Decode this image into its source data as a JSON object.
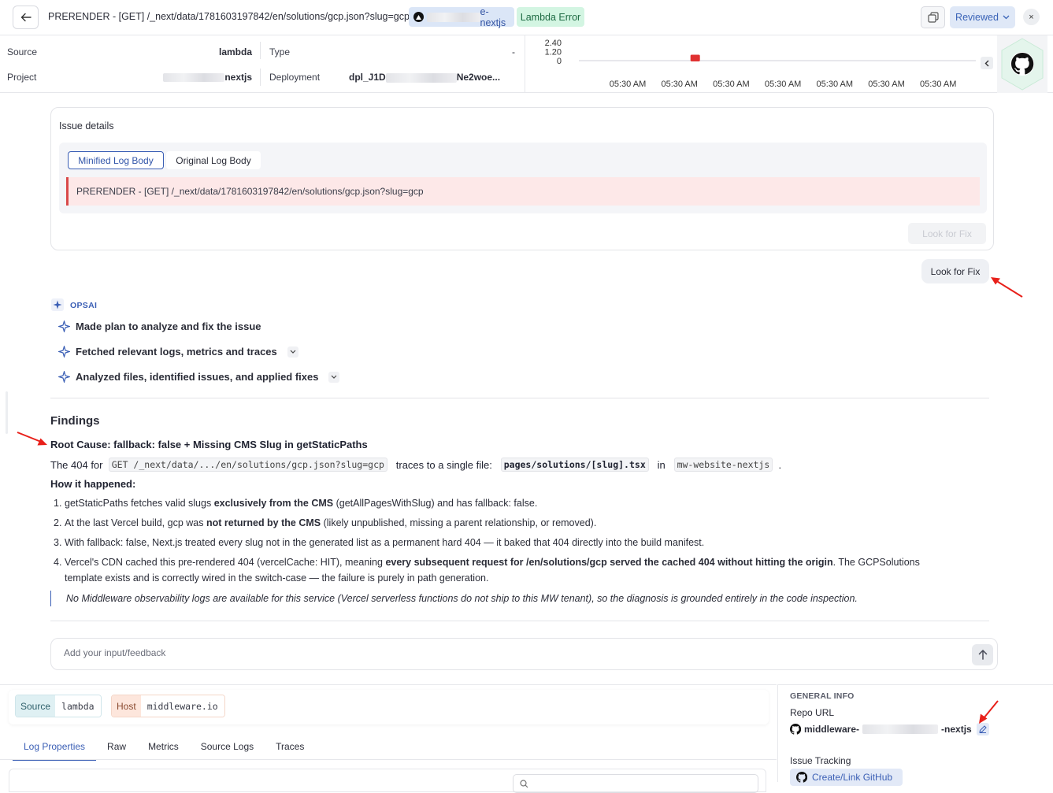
{
  "header": {
    "title": "PRERENDER - [GET] /_next/data/1781603197842/en/solutions/gcp.json?slug=gcp",
    "project_badge": "e-nextjs",
    "error_badge": "Lambda Error",
    "reviewed_label": "Reviewed",
    "close_glyph": "×"
  },
  "meta": {
    "source_label": "Source",
    "source_value": "lambda",
    "project_label": "Project",
    "project_value": "nextjs",
    "type_label": "Type",
    "type_value": "-",
    "deployment_label": "Deployment",
    "deployment_prefix": "dpl_J1D",
    "deployment_suffix": "Ne2woe..."
  },
  "chart_data": {
    "type": "bar",
    "y_ticks": [
      "2.40",
      "1.20",
      "0"
    ],
    "ylim": [
      0,
      2.4
    ],
    "categories": [
      "05:30 AM",
      "05:30 AM",
      "05:30 AM",
      "05:30 AM",
      "05:30 AM",
      "05:30 AM",
      "05:30 AM"
    ],
    "bar_color": "#e03131",
    "series": [
      {
        "values": [
          0,
          1.2,
          0,
          0,
          0,
          0,
          0
        ]
      }
    ]
  },
  "issue": {
    "title": "Issue details",
    "tab_minified": "Minified Log Body",
    "tab_original": "Original Log Body",
    "log_body": "PRERENDER - [GET] /_next/data/1781603197842/en/solutions/gcp.json?slug=gcp",
    "look_for_fix_disabled": "Look for Fix"
  },
  "chat": {
    "user_message": "Look for Fix",
    "agent_name": "OPSAI",
    "steps": [
      "Made plan to analyze and fix the issue",
      "Fetched relevant logs, metrics and traces",
      "Analyzed files, identified issues, and applied fixes"
    ]
  },
  "findings": {
    "heading": "Findings",
    "root_cause": "Root Cause: fallback: false + Missing CMS Slug in getStaticPaths",
    "line_prefix": "The 404 for",
    "code_path": "GET /_next/data/.../en/solutions/gcp.json?slug=gcp",
    "line_mid": "traces to a single file:",
    "code_file": "pages/solutions/[slug].tsx",
    "line_in": "in",
    "code_repo": "mw-website-nextjs",
    "line_end": ".",
    "how_heading": "How it happened:",
    "items": [
      {
        "num": "1.",
        "pre": "getStaticPaths fetches valid slugs ",
        "bold": "exclusively from the CMS",
        "post": " (getAllPagesWithSlug) and has fallback: false.",
        "bold2": "",
        "post2": ""
      },
      {
        "num": "2.",
        "pre": "At the last Vercel build, gcp was ",
        "bold": "not returned by the CMS",
        "post": " (likely unpublished, missing a parent relationship, or removed).",
        "bold2": "",
        "post2": ""
      },
      {
        "num": "3.",
        "pre": "With fallback: false, Next.js treated every slug not in the generated list as a permanent hard 404 — it baked that 404 directly into the build manifest.",
        "bold": "",
        "post": "",
        "bold2": "",
        "post2": ""
      },
      {
        "num": "4.",
        "pre": "Vercel's CDN cached this pre-rendered 404 (vercelCache: HIT), meaning ",
        "bold": "every subsequent request for /en/solutions/gcp served the cached 404 without hitting the origin",
        "post": ". The GCPSolutions",
        "bold2": "",
        "post2": "template exists and is correctly wired in the switch-case — the failure is purely in path generation."
      }
    ],
    "note": "No Middleware observability logs are available for this service (Vercel serverless functions do not ship to this MW tenant), so the diagnosis is grounded entirely in the code inspection."
  },
  "feedback": {
    "placeholder": "Add your input/feedback"
  },
  "bottom": {
    "tags": [
      {
        "key": "Source",
        "value": "lambda"
      },
      {
        "key": "Host",
        "value": "middleware.io"
      }
    ],
    "tabs": [
      "Log Properties",
      "Raw",
      "Metrics",
      "Source Logs",
      "Traces"
    ]
  },
  "general_info": {
    "heading": "GENERAL INFO",
    "repo_label": "Repo URL",
    "repo_prefix": "middleware-",
    "repo_suffix": "-nextjs",
    "issue_tracking_label": "Issue Tracking",
    "link_label": "Create/Link GitHub"
  },
  "colors": {
    "accent": "#3b5fb5",
    "error_bg": "#fde8e8",
    "error_border": "#d94a4a",
    "annotation_arrow": "#e8201a"
  },
  "icons": [
    "back-arrow-icon",
    "vercel-icon",
    "copy-icon",
    "chevron-down-icon",
    "close-icon",
    "github-icon",
    "sparkle-icon",
    "send-arrow-icon",
    "edit-icon",
    "search-icon"
  ]
}
